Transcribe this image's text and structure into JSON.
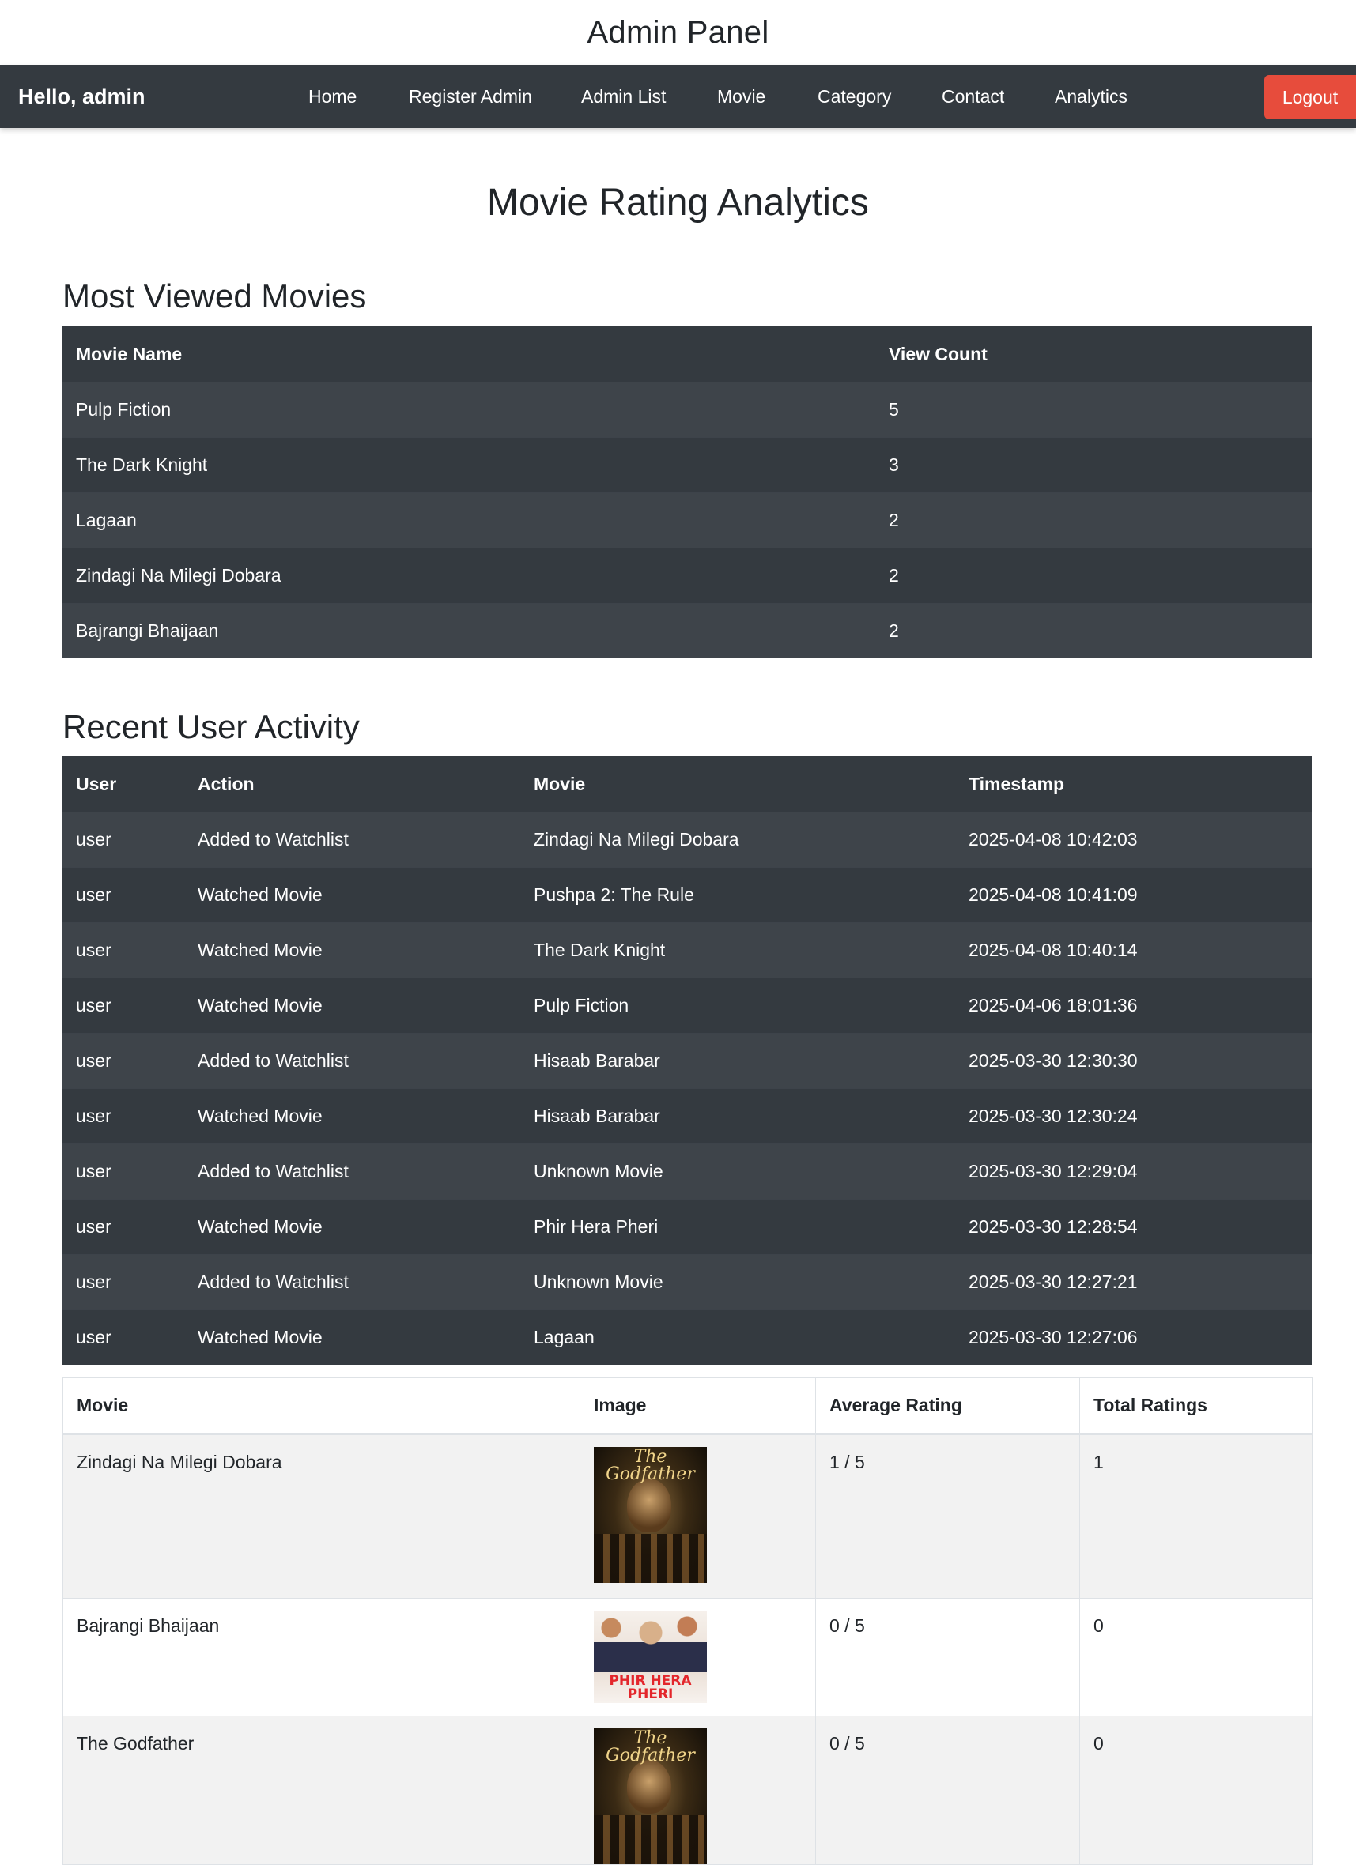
{
  "page_title": "Admin Panel",
  "navbar": {
    "greeting": "Hello, admin",
    "items": [
      "Home",
      "Register Admin",
      "Admin List",
      "Movie",
      "Category",
      "Contact",
      "Analytics"
    ],
    "logout_label": "Logout"
  },
  "heading": "Movie Rating Analytics",
  "most_viewed": {
    "title": "Most Viewed Movies",
    "headers": [
      "Movie Name",
      "View Count"
    ],
    "rows": [
      [
        "Pulp Fiction",
        "5"
      ],
      [
        "The Dark Knight",
        "3"
      ],
      [
        "Lagaan",
        "2"
      ],
      [
        "Zindagi Na Milegi Dobara",
        "2"
      ],
      [
        "Bajrangi Bhaijaan",
        "2"
      ]
    ]
  },
  "recent_activity": {
    "title": "Recent User Activity",
    "headers": [
      "User",
      "Action",
      "Movie",
      "Timestamp"
    ],
    "rows": [
      [
        "user",
        "Added to Watchlist",
        "Zindagi Na Milegi Dobara",
        "2025-04-08 10:42:03"
      ],
      [
        "user",
        "Watched Movie",
        "Pushpa 2: The Rule",
        "2025-04-08 10:41:09"
      ],
      [
        "user",
        "Watched Movie",
        "The Dark Knight",
        "2025-04-08 10:40:14"
      ],
      [
        "user",
        "Watched Movie",
        "Pulp Fiction",
        "2025-04-06 18:01:36"
      ],
      [
        "user",
        "Added to Watchlist",
        "Hisaab Barabar",
        "2025-03-30 12:30:30"
      ],
      [
        "user",
        "Watched Movie",
        "Hisaab Barabar",
        "2025-03-30 12:30:24"
      ],
      [
        "user",
        "Added to Watchlist",
        "Unknown Movie",
        "2025-03-30 12:29:04"
      ],
      [
        "user",
        "Watched Movie",
        "Phir Hera Pheri",
        "2025-03-30 12:28:54"
      ],
      [
        "user",
        "Added to Watchlist",
        "Unknown Movie",
        "2025-03-30 12:27:21"
      ],
      [
        "user",
        "Watched Movie",
        "Lagaan",
        "2025-03-30 12:27:06"
      ]
    ]
  },
  "ratings": {
    "headers": [
      "Movie",
      "Image",
      "Average Rating",
      "Total Ratings"
    ],
    "rows": [
      {
        "movie": "Zindagi Na Milegi Dobara",
        "poster": "godfather",
        "poster_text": "The Godfather",
        "avg": "1 / 5",
        "total": "1"
      },
      {
        "movie": "Bajrangi Bhaijaan",
        "poster": "phir-hera-pheri",
        "poster_text": "PHIR HERA PHERI",
        "avg": "0 / 5",
        "total": "0"
      },
      {
        "movie": "The Godfather",
        "poster": "godfather",
        "poster_text": "The Godfather",
        "avg": "0 / 5",
        "total": "0"
      }
    ]
  },
  "colors": {
    "navbar_bg": "#343a40",
    "logout_bg": "#e74c3c",
    "table_dark_odd": "#3e444a",
    "table_dark_even": "#343a40"
  }
}
